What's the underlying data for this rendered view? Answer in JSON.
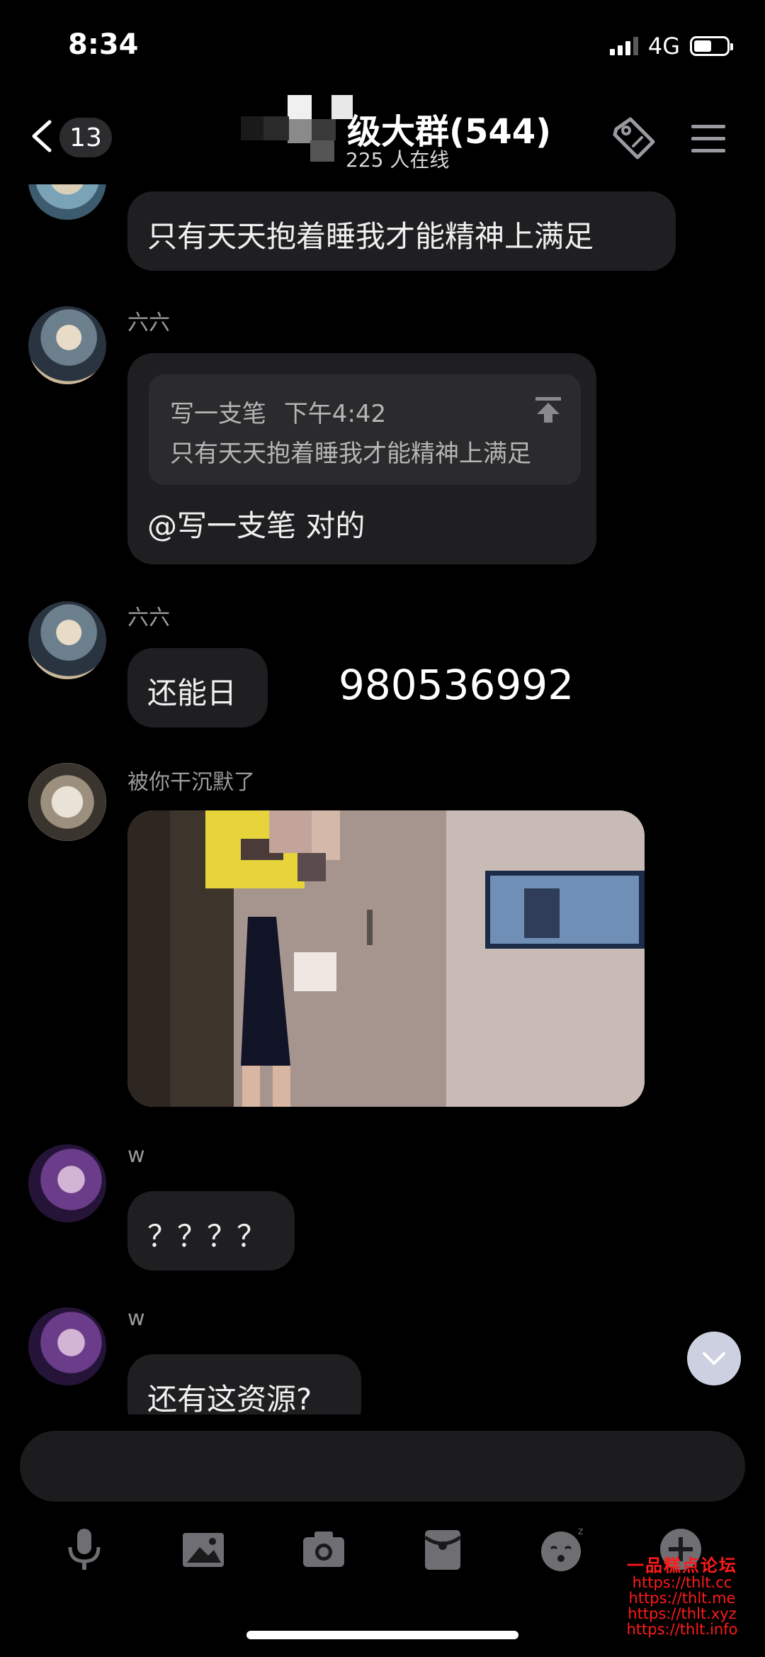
{
  "status_bar": {
    "time": "8:34",
    "network": "4G"
  },
  "header": {
    "back_count": "13",
    "title": "级大群(544)",
    "subtitle": "225 人在线",
    "icons": [
      "back-chevron-icon",
      "tag-icon",
      "menu-icon"
    ]
  },
  "messages": [
    {
      "type": "text",
      "sender": "",
      "text": "只有天天抱着睡我才能精神上满足"
    },
    {
      "type": "reply",
      "sender": "六六",
      "quote_author": "写一支笔",
      "quote_time": "下午4:42",
      "quote_text": "只有天天抱着睡我才能精神上满足",
      "text": "@写一支笔 对的"
    },
    {
      "type": "text",
      "sender": "六六",
      "text": "还能日"
    },
    {
      "type": "image",
      "sender": "被你干沉默了"
    },
    {
      "type": "text",
      "sender": "w",
      "text": "？？？？"
    },
    {
      "type": "text",
      "sender": "w",
      "text": "还有这资源?"
    }
  ],
  "overlay_number": "980536992",
  "toolbar_icons": [
    "microphone-icon",
    "image-icon",
    "camera-icon",
    "red-packet-icon",
    "emoji-icon",
    "plus-icon"
  ],
  "watermark": {
    "title": "一品糕点论坛",
    "lines": [
      "https://thlt.cc",
      "https://thlt.me",
      "https://thlt.xyz",
      "https://thlt.info"
    ]
  }
}
